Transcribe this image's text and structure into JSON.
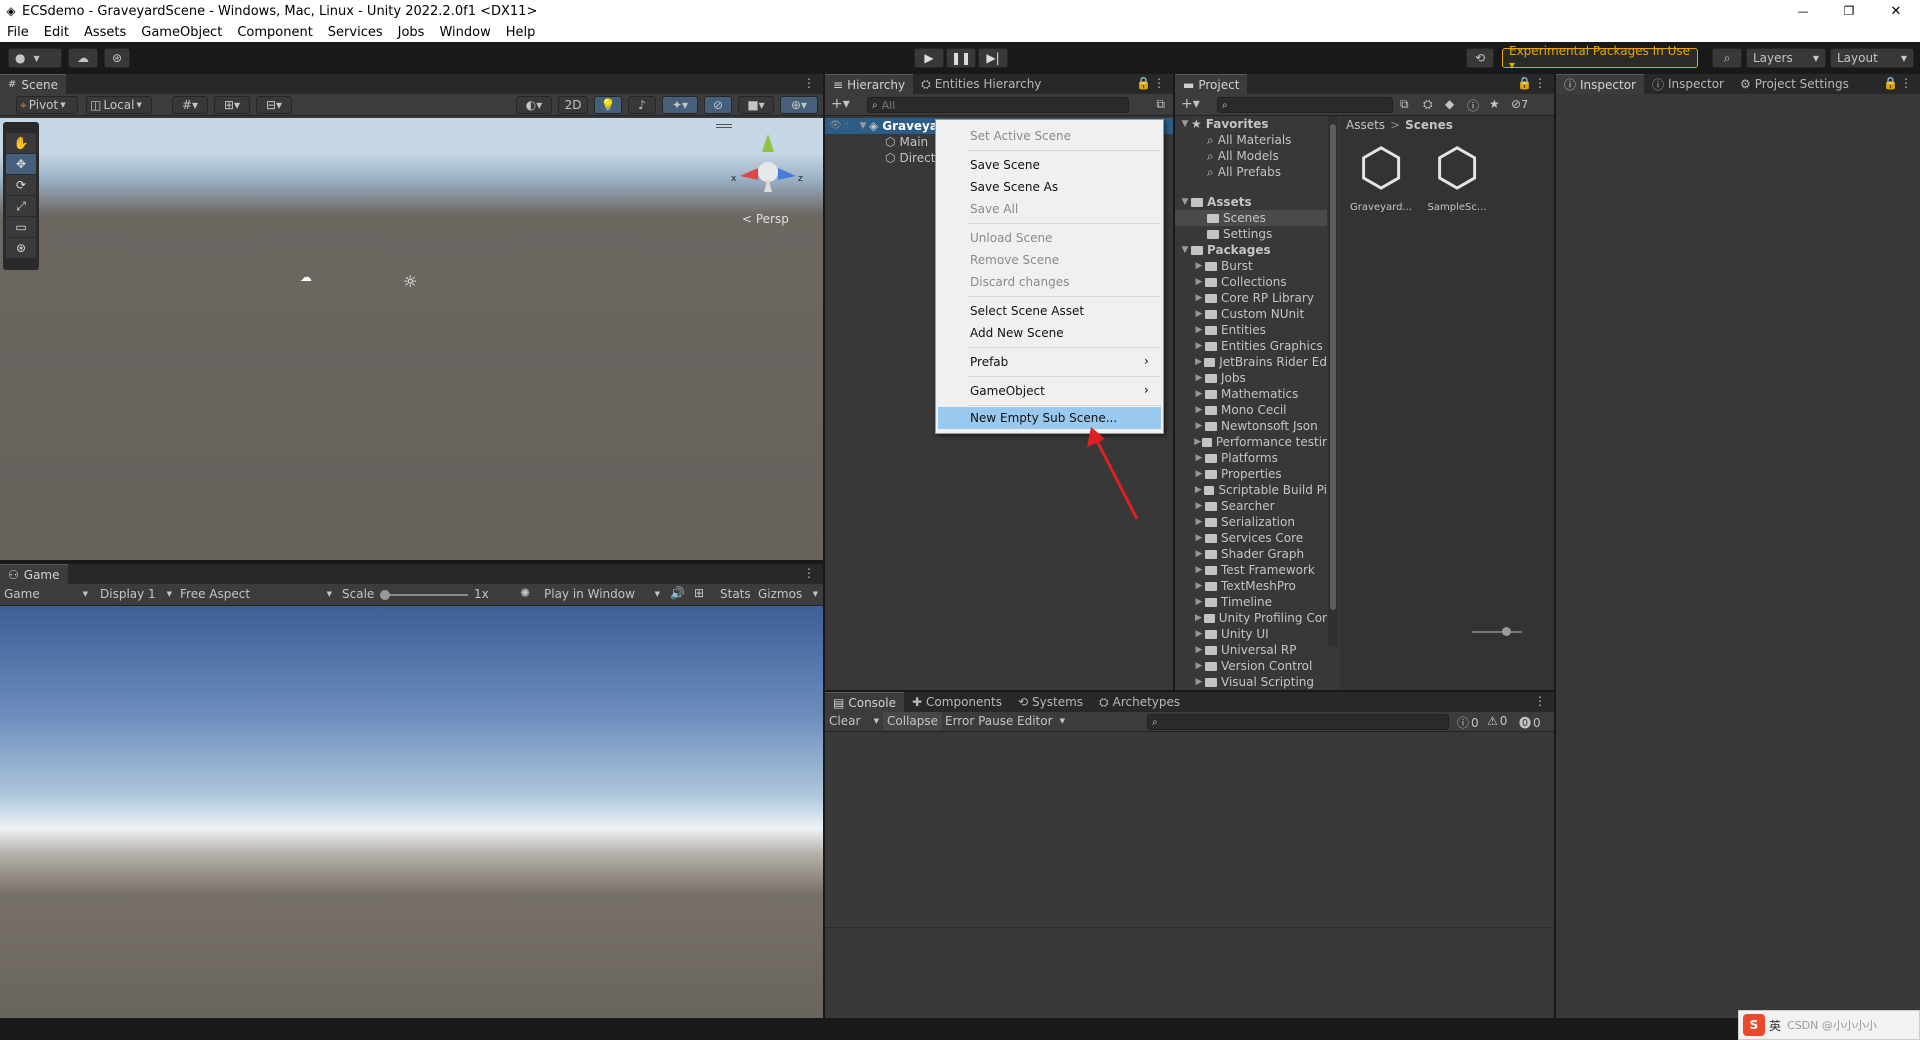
{
  "window": {
    "title": "ECSdemo - GraveyardScene - Windows, Mac, Linux - Unity 2022.2.0f1 <DX11>",
    "minimize_glyph": "—",
    "restore_glyph": "❐",
    "close_glyph": "✕"
  },
  "menubar": [
    "File",
    "Edit",
    "Assets",
    "GameObject",
    "Component",
    "Services",
    "Jobs",
    "Window",
    "Help"
  ],
  "toolbar": {
    "experimental_label": "Experimental Packages In Use ▾",
    "layers_label": "Layers",
    "layout_label": "Layout",
    "accent_color": "#e8a400"
  },
  "scene": {
    "tab_label": "Scene",
    "pivot_label": "Pivot",
    "local_label": "Local",
    "mode_2d": "2D",
    "persp_label": "< Persp",
    "gizmo_x": "x",
    "gizmo_z": "z"
  },
  "game": {
    "tab_label": "Game",
    "game_dropdown": "Game",
    "display_dropdown": "Display 1",
    "aspect_dropdown": "Free Aspect",
    "scale_label": "Scale",
    "scale_value": "1x",
    "play_mode": "Play in Window",
    "stats_label": "Stats",
    "gizmos_label": "Gizmos"
  },
  "hierarchy": {
    "tab_label": "Hierarchy",
    "tab2_label": "Entities Hierarchy",
    "search_placeholder": "All",
    "root": "GraveyardScene",
    "items": [
      "Main",
      "Direct"
    ]
  },
  "context_menu": {
    "set_active": "Set Active Scene",
    "save_scene": "Save Scene",
    "save_scene_as": "Save Scene As",
    "save_all": "Save All",
    "unload_scene": "Unload Scene",
    "remove_scene": "Remove Scene",
    "discard_changes": "Discard changes",
    "select_scene_asset": "Select Scene Asset",
    "add_new_scene": "Add New Scene",
    "prefab": "Prefab",
    "gameobject": "GameObject",
    "new_empty_sub_scene": "New Empty Sub Scene...",
    "highlight_color": "#99c9ef",
    "arrow_color": "#e02020"
  },
  "project": {
    "tab_label": "Project",
    "hidden_count": "7",
    "favorites_label": "Favorites",
    "favorites": [
      "All Materials",
      "All Models",
      "All Prefabs"
    ],
    "assets_label": "Assets",
    "assets_children": [
      "Scenes",
      "Settings"
    ],
    "packages_label": "Packages",
    "packages": [
      "Burst",
      "Collections",
      "Core RP Library",
      "Custom NUnit",
      "Entities",
      "Entities Graphics",
      "JetBrains Rider Ed",
      "Jobs",
      "Mathematics",
      "Mono Cecil",
      "Newtonsoft Json",
      "Performance testir",
      "Platforms",
      "Properties",
      "Scriptable Build Pi",
      "Searcher",
      "Serialization",
      "Services Core",
      "Shader Graph",
      "Test Framework",
      "TextMeshPro",
      "Timeline",
      "Unity Profiling Cor",
      "Unity UI",
      "Universal RP",
      "Version Control",
      "Visual Scripting"
    ],
    "breadcrumb_root": "Assets",
    "breadcrumb_sep": ">",
    "breadcrumb_current": "Scenes",
    "files": [
      "Graveyard...",
      "SampleSc..."
    ]
  },
  "console": {
    "tabs": [
      "Console",
      "Components",
      "Systems",
      "Archetypes"
    ],
    "clear_label": "Clear",
    "collapse_label": "Collapse",
    "error_pause_label": "Error Pause",
    "editor_label": "Editor",
    "log_count": "0",
    "warn_count": "0",
    "error_count": "0"
  },
  "inspector": {
    "tab1": "Inspector",
    "tab2": "Inspector",
    "tab3": "Project Settings"
  },
  "taskbar": {
    "ime_label": "英",
    "watermark": "CSDN @小小小小"
  }
}
